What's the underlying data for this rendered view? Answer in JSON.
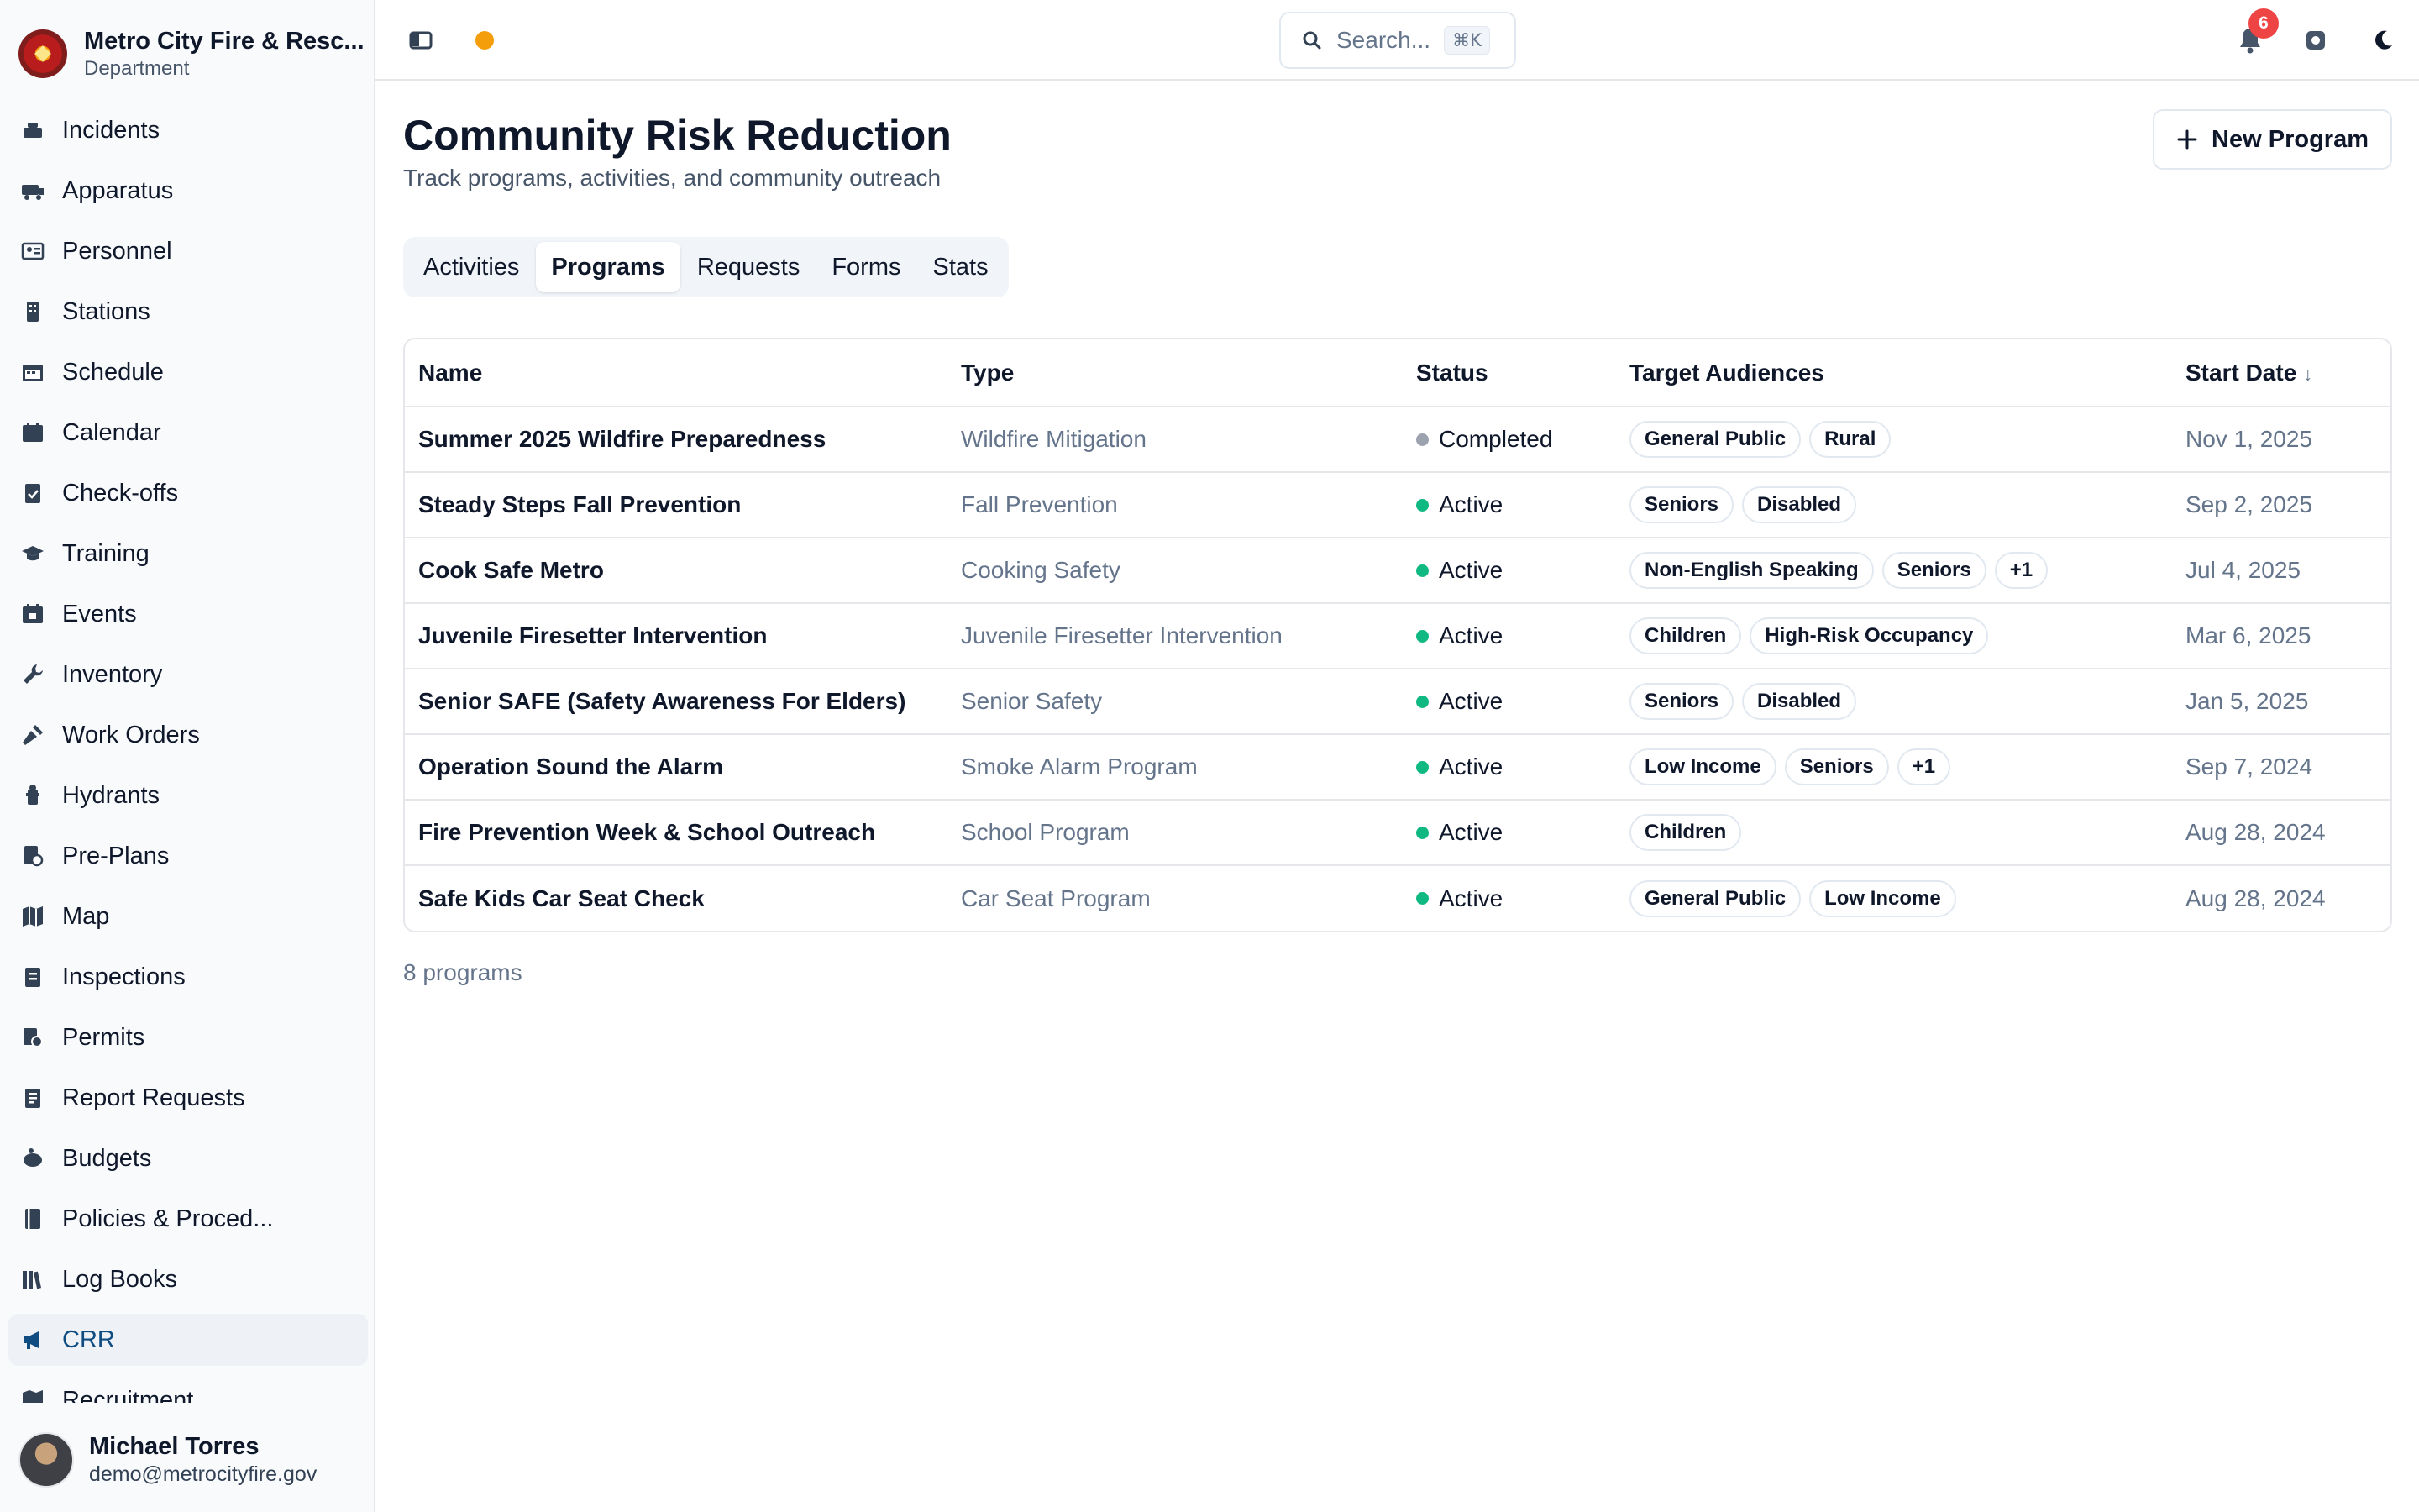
{
  "org": {
    "name": "Metro City Fire & Resc...",
    "subtitle": "Department"
  },
  "sidebar": {
    "items": [
      {
        "label": "Incidents",
        "icon": "incidents-icon",
        "active": false
      },
      {
        "label": "Apparatus",
        "icon": "apparatus-icon",
        "active": false
      },
      {
        "label": "Personnel",
        "icon": "personnel-icon",
        "active": false
      },
      {
        "label": "Stations",
        "icon": "stations-icon",
        "active": false
      },
      {
        "label": "Schedule",
        "icon": "schedule-icon",
        "active": false
      },
      {
        "label": "Calendar",
        "icon": "calendar-icon",
        "active": false
      },
      {
        "label": "Check-offs",
        "icon": "clipboard-check-icon",
        "active": false
      },
      {
        "label": "Training",
        "icon": "graduation-cap-icon",
        "active": false
      },
      {
        "label": "Events",
        "icon": "events-icon",
        "active": false
      },
      {
        "label": "Inventory",
        "icon": "wrench-icon",
        "active": false
      },
      {
        "label": "Work Orders",
        "icon": "work-orders-icon",
        "active": false
      },
      {
        "label": "Hydrants",
        "icon": "hydrant-icon",
        "active": false
      },
      {
        "label": "Pre-Plans",
        "icon": "pre-plans-icon",
        "active": false
      },
      {
        "label": "Map",
        "icon": "map-icon",
        "active": false
      },
      {
        "label": "Inspections",
        "icon": "inspections-icon",
        "active": false
      },
      {
        "label": "Permits",
        "icon": "permits-icon",
        "active": false
      },
      {
        "label": "Report Requests",
        "icon": "report-requests-icon",
        "active": false
      },
      {
        "label": "Budgets",
        "icon": "piggy-bank-icon",
        "active": false
      },
      {
        "label": "Policies & Proced...",
        "icon": "book-icon",
        "active": false
      },
      {
        "label": "Log Books",
        "icon": "log-books-icon",
        "active": false
      },
      {
        "label": "CRR",
        "icon": "megaphone-icon",
        "active": true
      },
      {
        "label": "Recruitment",
        "icon": "recruitment-icon",
        "active": false
      }
    ]
  },
  "user": {
    "name": "Michael Torres",
    "email": "demo@metrocityfire.gov"
  },
  "topbar": {
    "search_placeholder": "Search...",
    "search_shortcut": "⌘K",
    "notification_count": "6",
    "status_dot_color": "#f59e0b"
  },
  "page": {
    "title": "Community Risk Reduction",
    "subtitle": "Track programs, activities, and community outreach",
    "new_button_label": "New Program"
  },
  "tabs": [
    {
      "label": "Activities",
      "active": false
    },
    {
      "label": "Programs",
      "active": true
    },
    {
      "label": "Requests",
      "active": false
    },
    {
      "label": "Forms",
      "active": false
    },
    {
      "label": "Stats",
      "active": false
    }
  ],
  "table": {
    "columns": [
      "Name",
      "Type",
      "Status",
      "Target Audiences",
      "Start Date"
    ],
    "sort_indicator": "↓",
    "rows": [
      {
        "name": "Summer 2025 Wildfire Preparedness",
        "type": "Wildfire Mitigation",
        "status": "Completed",
        "status_color": "#9ca3af",
        "audiences": [
          "General Public",
          "Rural"
        ],
        "start_date": "Nov 1, 2025"
      },
      {
        "name": "Steady Steps Fall Prevention",
        "type": "Fall Prevention",
        "status": "Active",
        "status_color": "#10b981",
        "audiences": [
          "Seniors",
          "Disabled"
        ],
        "start_date": "Sep 2, 2025"
      },
      {
        "name": "Cook Safe Metro",
        "type": "Cooking Safety",
        "status": "Active",
        "status_color": "#10b981",
        "audiences": [
          "Non-English Speaking",
          "Seniors",
          "+1"
        ],
        "start_date": "Jul 4, 2025"
      },
      {
        "name": "Juvenile Firesetter Intervention",
        "type": "Juvenile Firesetter Intervention",
        "status": "Active",
        "status_color": "#10b981",
        "audiences": [
          "Children",
          "High-Risk Occupancy"
        ],
        "start_date": "Mar 6, 2025"
      },
      {
        "name": "Senior SAFE (Safety Awareness For Elders)",
        "type": "Senior Safety",
        "status": "Active",
        "status_color": "#10b981",
        "audiences": [
          "Seniors",
          "Disabled"
        ],
        "start_date": "Jan 5, 2025"
      },
      {
        "name": "Operation Sound the Alarm",
        "type": "Smoke Alarm Program",
        "status": "Active",
        "status_color": "#10b981",
        "audiences": [
          "Low Income",
          "Seniors",
          "+1"
        ],
        "start_date": "Sep 7, 2024"
      },
      {
        "name": "Fire Prevention Week & School Outreach",
        "type": "School Program",
        "status": "Active",
        "status_color": "#10b981",
        "audiences": [
          "Children"
        ],
        "start_date": "Aug 28, 2024"
      },
      {
        "name": "Safe Kids Car Seat Check",
        "type": "Car Seat Program",
        "status": "Active",
        "status_color": "#10b981",
        "audiences": [
          "General Public",
          "Low Income"
        ],
        "start_date": "Aug 28, 2024"
      }
    ],
    "count_label": "8 programs"
  }
}
